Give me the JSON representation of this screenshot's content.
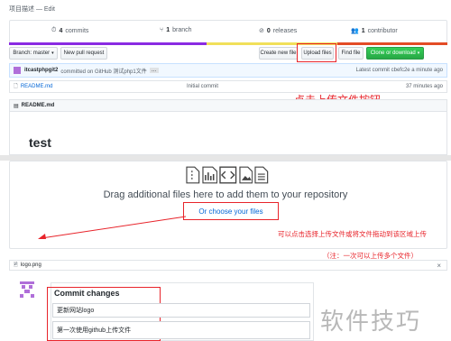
{
  "repo": {
    "description": "项目描述 — Edit",
    "stats": [
      {
        "count": "4",
        "label": "commits"
      },
      {
        "count": "1",
        "label": "branch"
      },
      {
        "count": "0",
        "label": "releases"
      },
      {
        "count": "1",
        "label": "contributor"
      }
    ]
  },
  "toolbar": {
    "branch_label": "Branch: master",
    "new_pull_request": "New pull request",
    "create_new_file": "Create new file",
    "upload_files": "Upload files",
    "find_file": "Find file",
    "clone_download": "Clone or download"
  },
  "commit_bar": {
    "author": "itcastphpgit2",
    "text": "committed on GitHub 测试php1文件",
    "ellipsis": "…",
    "latest": "Latest commit cbefc2e a minute ago"
  },
  "files": [
    {
      "name": "README.md",
      "message": "Initial commit",
      "age": "37 minutes ago"
    }
  ],
  "readme": {
    "header": "README.md",
    "heading": "test"
  },
  "annotations": {
    "upload_hint": "点击上传文件按钮",
    "choose_hint": "可以点击选择上传文件或将文件拖动到该区域上传",
    "choose_hint_note": "（注：一次可以上传多个文件）"
  },
  "upload": {
    "title": "Drag additional files here to add them to your repository",
    "choose_link": "Or choose your files",
    "uploaded_file": "logo.png",
    "remove": "×"
  },
  "commit_changes": {
    "title": "Commit changes",
    "summary_value": "更新网站logo",
    "description_value": "第一次使用github上传文件"
  },
  "watermark": "软件技巧",
  "colors": {
    "accent_red": "#e8242b",
    "link_blue": "#0366d6",
    "green_button": "#28a745",
    "commit_bar_bg": "#f1f8ff"
  },
  "language_bar": {
    "segments": [
      {
        "color": "#8a2be2",
        "share": 0.45
      },
      {
        "color": "#f1e05a",
        "share": 0.3
      },
      {
        "color": "#e34c26",
        "share": 0.25
      }
    ]
  }
}
